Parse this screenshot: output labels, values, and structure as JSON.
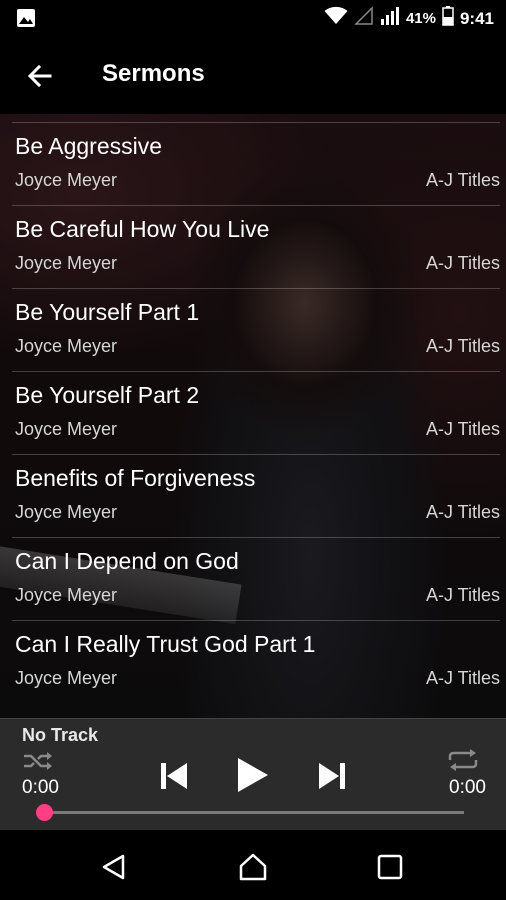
{
  "status_bar": {
    "battery": "41%",
    "time": "9:41",
    "icons": [
      "image-notification-icon",
      "wifi-icon",
      "signal-empty-icon",
      "signal-icon",
      "battery-icon"
    ]
  },
  "app_bar": {
    "title": "Sermons",
    "back_icon": "arrow-left-icon"
  },
  "sermons": [
    {
      "title": "Be Aggressive",
      "artist": "Joyce Meyer",
      "category": "A-J Titles"
    },
    {
      "title": "Be Careful How You Live",
      "artist": "Joyce Meyer",
      "category": "A-J Titles"
    },
    {
      "title": "Be Yourself Part 1",
      "artist": "Joyce Meyer",
      "category": "A-J Titles"
    },
    {
      "title": "Be Yourself Part 2",
      "artist": "Joyce Meyer",
      "category": "A-J Titles"
    },
    {
      "title": "Benefits of Forgiveness",
      "artist": "Joyce Meyer",
      "category": "A-J Titles"
    },
    {
      "title": "Can I Depend on God",
      "artist": "Joyce Meyer",
      "category": "A-J Titles"
    },
    {
      "title": "Can I Really Trust God Part 1",
      "artist": "Joyce Meyer",
      "category": "A-J Titles"
    }
  ],
  "player": {
    "track_name": "No Track",
    "elapsed": "0:00",
    "duration": "0:00",
    "progress": 0,
    "accent_color": "#ff3e86",
    "icons": [
      "shuffle-icon",
      "previous-icon",
      "play-icon",
      "next-icon",
      "repeat-icon"
    ]
  },
  "nav_bar": {
    "icons": [
      "back-triangle-icon",
      "home-icon",
      "recents-icon"
    ]
  }
}
